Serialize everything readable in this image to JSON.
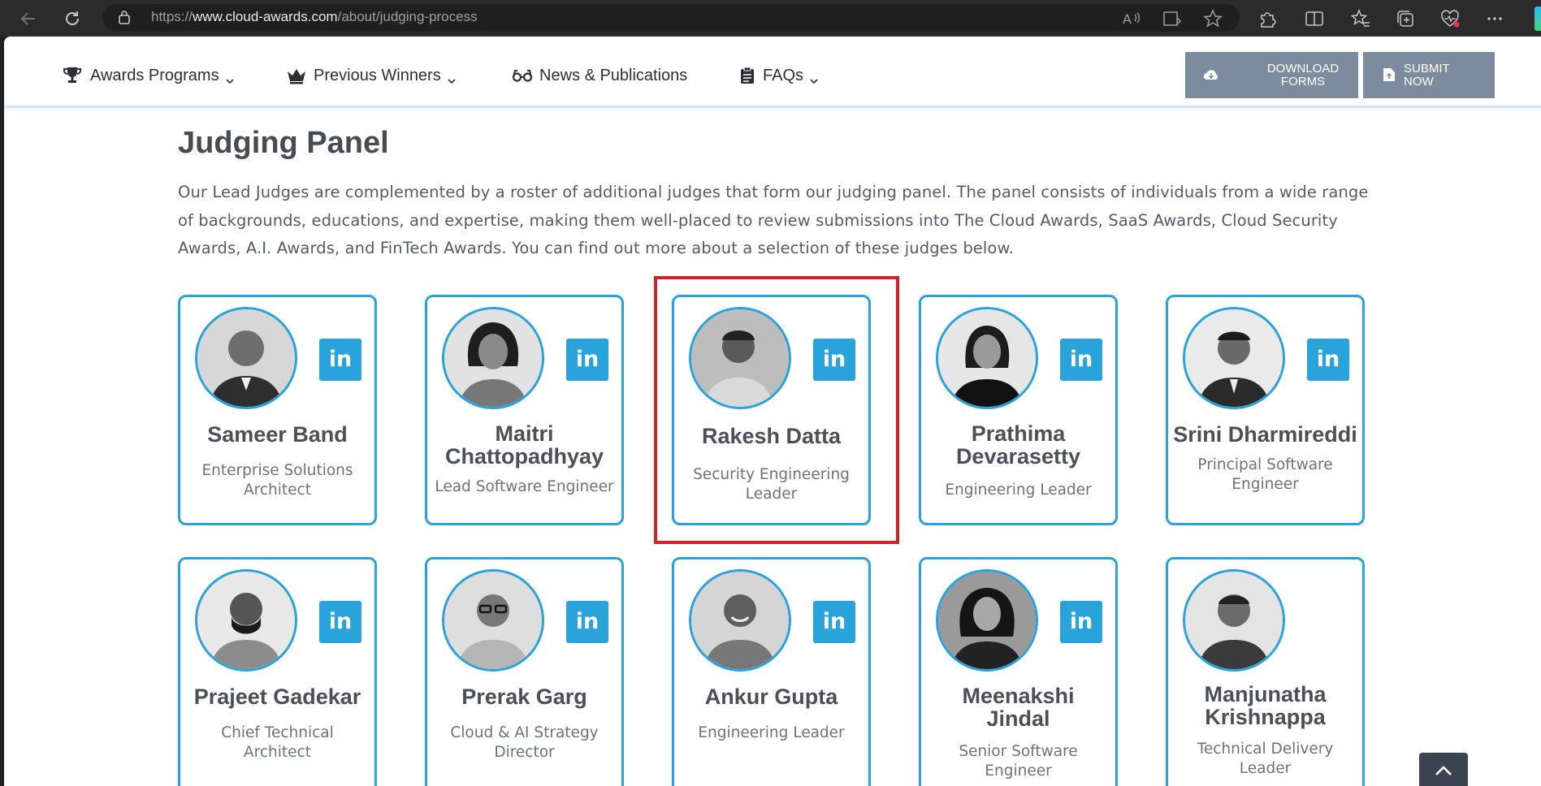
{
  "browser": {
    "url_prefix": "https://",
    "url_host": "www.cloud-awards.com",
    "url_path": "/about/judging-process",
    "icons": [
      "back-icon",
      "reload-icon",
      "lock-icon",
      "read-aloud-icon",
      "immersive-reader-icon",
      "favorite-icon",
      "extensions-icon",
      "split-screen-icon",
      "favorites-icon",
      "collections-icon",
      "health-icon",
      "more-icon"
    ]
  },
  "header": {
    "menu": [
      {
        "label": "Awards Programs",
        "icon": "trophy-icon",
        "has_dropdown": true
      },
      {
        "label": "Previous Winners",
        "icon": "crown-icon",
        "has_dropdown": true
      },
      {
        "label": "News & Publications",
        "icon": "glasses-icon",
        "has_dropdown": false
      },
      {
        "label": "FAQs",
        "icon": "clipboard-icon",
        "has_dropdown": true
      }
    ],
    "download_line1": "DOWNLOAD",
    "download_line2": "FORMS",
    "submit_line1": "SUBMIT",
    "submit_line2": "NOW",
    "button_color": "#7d8b9e"
  },
  "content": {
    "title": "Judging Panel",
    "intro": "Our Lead Judges are complemented by a roster of additional judges that form our judging panel. The panel consists of individuals from a wide range of backgrounds, educations, and expertise, making them well-placed to review submissions into The Cloud Awards, SaaS Awards, Cloud Security Awards, A.I. Awards, and FinTech Awards. You can find out more about a selection of these judges below.",
    "accent_color": "#2aa3dd",
    "highlight_color": "#d1222a",
    "linkedin_label": "in"
  },
  "judges": [
    {
      "name_1": "Sameer Band",
      "name_2": "",
      "role_1": "Enterprise Solutions",
      "role_2": "Architect",
      "linkedin": true
    },
    {
      "name_1": "Maitri",
      "name_2": "Chattopadhyay",
      "role_1": "Lead Software Engineer",
      "role_2": "",
      "linkedin": true
    },
    {
      "name_1": "Rakesh Datta",
      "name_2": "",
      "role_1": "Security Engineering",
      "role_2": "Leader",
      "linkedin": true,
      "highlighted": true
    },
    {
      "name_1": "Prathima",
      "name_2": "Devarasetty",
      "role_1": "Engineering Leader",
      "role_2": "",
      "linkedin": true
    },
    {
      "name_1": "Srini Dharmireddi",
      "name_2": "",
      "role_1": "Principal Software",
      "role_2": "Engineer",
      "linkedin": true
    },
    {
      "name_1": "Prajeet Gadekar",
      "name_2": "",
      "role_1": "Chief Technical",
      "role_2": "Architect",
      "linkedin": true
    },
    {
      "name_1": "Prerak Garg",
      "name_2": "",
      "role_1": "Cloud & AI Strategy",
      "role_2": "Director",
      "linkedin": true
    },
    {
      "name_1": "Ankur Gupta",
      "name_2": "",
      "role_1": "Engineering Leader",
      "role_2": "",
      "linkedin": true
    },
    {
      "name_1": "Meenakshi",
      "name_2": "Jindal",
      "role_1": "Senior Software",
      "role_2": "Engineer",
      "linkedin": true
    },
    {
      "name_1": "Manjunatha",
      "name_2": "Krishnappa",
      "role_1": "Technical Delivery",
      "role_2": "Leader",
      "linkedin": false
    }
  ]
}
